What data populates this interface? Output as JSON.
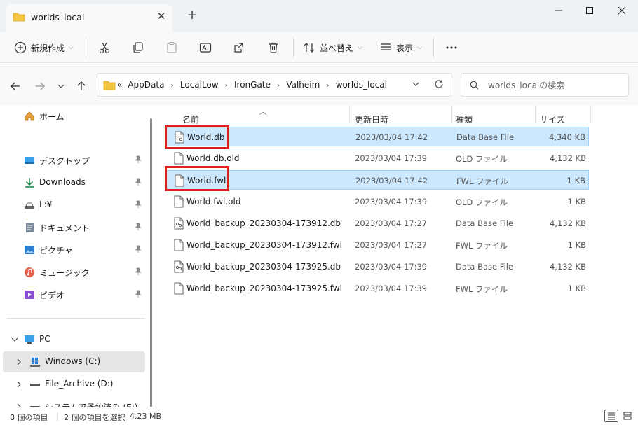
{
  "window": {
    "tab_title": "worlds_local",
    "tab_close": "✕",
    "new_tab": "+"
  },
  "toolbar": {
    "new_label": "新規作成",
    "sort_label": "並べ替え",
    "view_label": "表示",
    "more_label": "…"
  },
  "address": {
    "overflow": "«",
    "crumbs": [
      "AppData",
      "LocalLow",
      "IronGate",
      "Valheim",
      "worlds_local"
    ],
    "search_placeholder": "worlds_localの検索"
  },
  "sidebar": {
    "home": "ホーム",
    "quick": [
      {
        "label": "デスクトップ",
        "icon": "desktop-icon"
      },
      {
        "label": "Downloads",
        "icon": "download-icon"
      },
      {
        "label": "L:¥",
        "icon": "drive-icon"
      },
      {
        "label": "ドキュメント",
        "icon": "document-icon"
      },
      {
        "label": "ピクチャ",
        "icon": "pictures-icon"
      },
      {
        "label": "ミュージック",
        "icon": "music-icon"
      },
      {
        "label": "ビデオ",
        "icon": "video-icon"
      }
    ],
    "pc": "PC",
    "drives": [
      "Windows (C:)",
      "File_Archive (D:)",
      "システムで予約済み (E:)"
    ]
  },
  "columns": {
    "name": "名前",
    "date": "更新日時",
    "type": "種類",
    "size": "サイズ"
  },
  "files": [
    {
      "name": "World.db",
      "date": "2023/03/04 17:42",
      "type": "Data Base File",
      "size": "4,340 KB",
      "selected": true,
      "icon": "db-file-icon"
    },
    {
      "name": "World.db.old",
      "date": "2023/03/04 17:39",
      "type": "OLD ファイル",
      "size": "4,132 KB",
      "selected": false,
      "icon": "file-icon"
    },
    {
      "name": "World.fwl",
      "date": "2023/03/04 17:42",
      "type": "FWL ファイル",
      "size": "1 KB",
      "selected": true,
      "icon": "file-icon"
    },
    {
      "name": "World.fwl.old",
      "date": "2023/03/04 17:39",
      "type": "OLD ファイル",
      "size": "1 KB",
      "selected": false,
      "icon": "file-icon"
    },
    {
      "name": "World_backup_20230304-173912.db",
      "date": "2023/03/04 17:27",
      "type": "Data Base File",
      "size": "4,132 KB",
      "selected": false,
      "icon": "db-file-icon"
    },
    {
      "name": "World_backup_20230304-173912.fwl",
      "date": "2023/03/04 17:27",
      "type": "FWL ファイル",
      "size": "1 KB",
      "selected": false,
      "icon": "file-icon"
    },
    {
      "name": "World_backup_20230304-173925.db",
      "date": "2023/03/04 17:39",
      "type": "Data Base File",
      "size": "4,132 KB",
      "selected": false,
      "icon": "db-file-icon"
    },
    {
      "name": "World_backup_20230304-173925.fwl",
      "date": "2023/03/04 17:39",
      "type": "FWL ファイル",
      "size": "1 KB",
      "selected": false,
      "icon": "file-icon"
    }
  ],
  "status": {
    "count": "8 個の項目",
    "selection": "2 個の項目を選択",
    "size": "4.23 MB"
  },
  "colors": {
    "selection_bg": "#cce8ff",
    "selection_border": "#99d1ff",
    "highlight": "#e02020",
    "folder": "#f0c040"
  }
}
